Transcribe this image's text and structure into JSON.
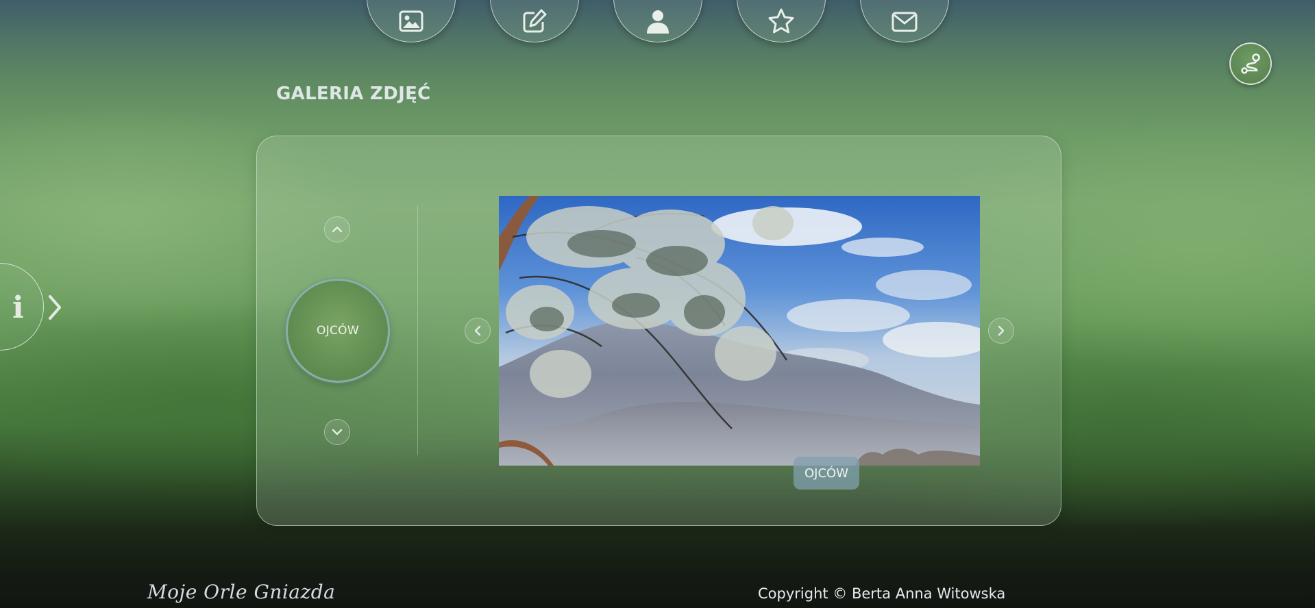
{
  "nav": {
    "icons": [
      "image-icon",
      "pencil-square-icon",
      "user-icon",
      "star-icon",
      "envelope-icon"
    ]
  },
  "route_icon": "route-icon",
  "page": {
    "title": "GALERIA ZDJĘĆ"
  },
  "info_tab": {
    "glyph": "i"
  },
  "gallery": {
    "category_label": "OJCÓW",
    "photo_caption": "OJCÓW"
  },
  "footer": {
    "logo": "Moje Orle Gniazda",
    "copyright": "Copyright © Berta Anna Witowska"
  },
  "colors": {
    "panel_border": "#e1ebe1",
    "route_button": "#5f8a55",
    "caption_bg": "#82a0af"
  }
}
